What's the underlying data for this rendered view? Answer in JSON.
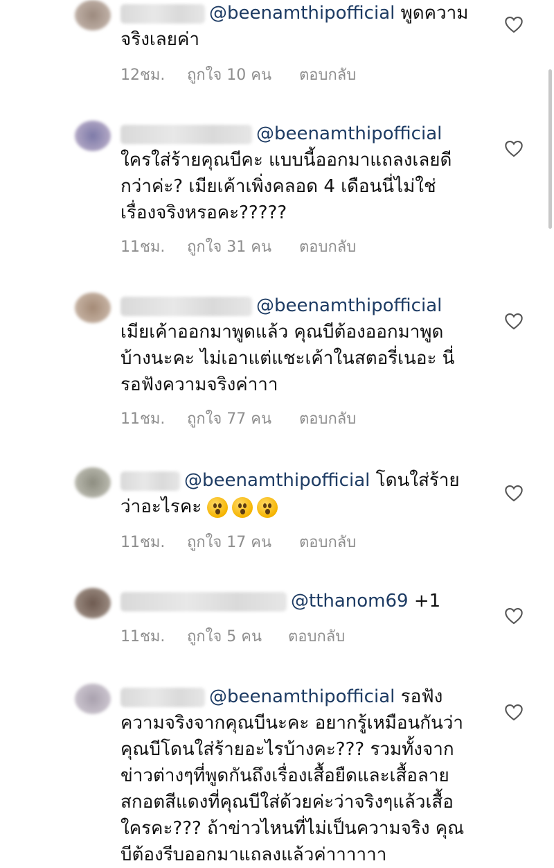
{
  "comments": [
    {
      "mention": "@beenamthipofficial",
      "lines": [
        "พูดความ",
        "จริงเลยค่า"
      ],
      "time": "12ชม.",
      "likes": "ถูกใจ 10 คน",
      "reply": "ตอบกลับ"
    },
    {
      "mention": "@beenamthipofficial",
      "lines": [
        "ใครใส่ร้ายคุณบีคะ แบบนี้ออกมาแถลงเลยดี",
        "กว่าค่ะ? เมียเค้าเพิ่งคลอด 4 เดือนนี่ไม่ใช่",
        "เรื่องจริงหรอคะ?????"
      ],
      "time": "11ชม.",
      "likes": "ถูกใจ 31 คน",
      "reply": "ตอบกลับ"
    },
    {
      "mention": "@beenamthipofficial",
      "lines": [
        "เมียเค้าออกมาพูดแล้ว คุณบีต้องออกมาพูด",
        "บ้างนะคะ ไม่เอาแต่แชะเค้าในสตอรี่เนอะ นี่",
        "รอฟังความจริงค่าาา"
      ],
      "time": "11ชม.",
      "likes": "ถูกใจ 77 คน",
      "reply": "ตอบกลับ"
    },
    {
      "mention": "@beenamthipofficial",
      "lines": [
        "โดนใส่ร้าย",
        "ว่าอะไรคะ"
      ],
      "emoji_count": 3,
      "time": "11ชม.",
      "likes": "ถูกใจ 17 คน",
      "reply": "ตอบกลับ"
    },
    {
      "mention": "@tthanom69",
      "lines": [
        "+1"
      ],
      "time": "11ชม.",
      "likes": "ถูกใจ 5 คน",
      "reply": "ตอบกลับ"
    },
    {
      "mention": "@beenamthipofficial",
      "lines": [
        "รอฟัง",
        "ความจริงจากคุณบีนะคะ อยากรู้เหมือนกันว่า",
        "คุณบีโดนใส่ร้ายอะไรบ้างคะ??? รวมทั้งจาก",
        "ข่าวต่างๆที่พูดกันถึงเรื่องเสื้อยืดและเสื้อลาย",
        "สกอตสีแดงที่คุณบีใส่ด้วยค่ะว่าจริงๆแล้วเสื้อ",
        "ใครคะ??? ถ้าข่าวไหนที่ไม่เป็นความจริง คุณ",
        "บีต้องรีบออกมาแถลงแล้วค่าาาาาา"
      ]
    }
  ],
  "icons": {
    "like": "heart-outline-icon",
    "emoji": "hushed-face-emoji"
  },
  "colors": {
    "mention": "#1d3b63",
    "meta": "#8e8e8e",
    "text": "#111111"
  }
}
